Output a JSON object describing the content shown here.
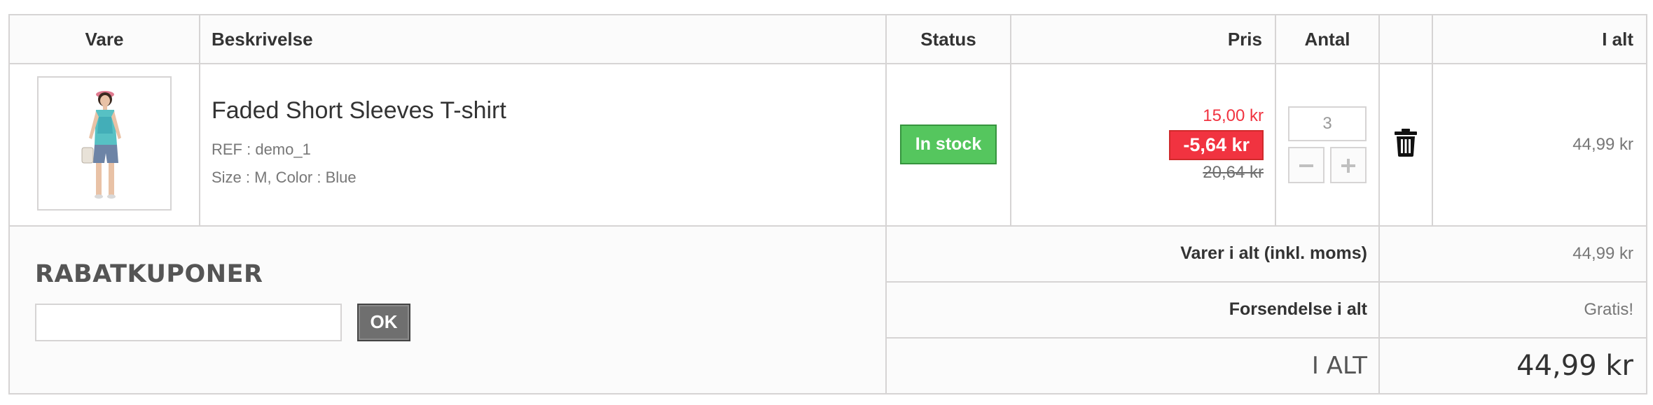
{
  "columns": {
    "product": "Vare",
    "description": "Beskrivelse",
    "status": "Status",
    "price": "Pris",
    "quantity": "Antal",
    "delete": "",
    "total": "I alt"
  },
  "item": {
    "name": "Faded Short Sleeves T-shirt",
    "ref": "REF : demo_1",
    "attributes": "Size : M, Color : Blue",
    "status": "In stock",
    "price_new": "15,00 kr",
    "discount": "-5,64 kr",
    "price_old": "20,64 kr",
    "quantity": "3",
    "total": "44,99 kr",
    "image_icon": "product-photo-woman-tshirt",
    "delete_icon": "trash-icon"
  },
  "coupon": {
    "title": "RABATKUPONER",
    "input_value": "",
    "submit_label": "OK"
  },
  "summary": {
    "products_label": "Varer i alt (inkl. moms)",
    "products_value": "44,99 kr",
    "shipping_label": "Forsendelse i alt",
    "shipping_value": "Gratis!",
    "total_label": "I ALT",
    "total_value": "44,99 kr"
  },
  "colors": {
    "in_stock": "#55c65e",
    "discount": "#f13340",
    "border": "#d6d4d4"
  }
}
